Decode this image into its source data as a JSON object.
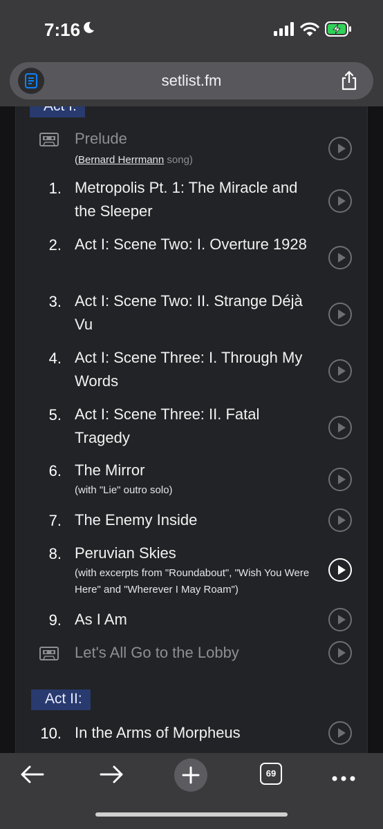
{
  "status": {
    "time": "7:16",
    "icons": [
      "moon-icon",
      "signal-icon",
      "wifi-icon",
      "battery-charging-icon"
    ],
    "battery_color": "#30d158"
  },
  "browser": {
    "url": "setlist.fm",
    "tab_count": "69"
  },
  "setlist": {
    "act1_label": "Act I:",
    "act2_label": "Act II:",
    "accent_color": "#283a6e",
    "items": [
      {
        "num": "",
        "title": "Prelude",
        "note_prefix": "(",
        "note_link": "Bernard Herrmann",
        "note_suffix": " song)",
        "tape": true
      },
      {
        "num": "1.",
        "title": "Metropolis Pt. 1: The Miracle and the Sleeper"
      },
      {
        "num": "2.",
        "title": "Act I: Scene Two: I. Overture 1928"
      },
      {
        "num": "3.",
        "title": "Act I: Scene Two: II. Strange Déjà Vu"
      },
      {
        "num": "4.",
        "title": "Act I: Scene Three: I. Through My Words"
      },
      {
        "num": "5.",
        "title": "Act I: Scene Three: II. Fatal Tragedy"
      },
      {
        "num": "6.",
        "title": "The Mirror",
        "note": "(with \"Lie\" outro solo)"
      },
      {
        "num": "7.",
        "title": "The Enemy Inside"
      },
      {
        "num": "8.",
        "title": "Peruvian Skies",
        "note": "(with excerpts from \"Roundabout\", \"Wish You Were Here\" and \"Wherever I May Roam\")"
      },
      {
        "num": "9.",
        "title": "As I Am"
      },
      {
        "num": "",
        "title": "Let's All Go to the Lobby",
        "tape": true
      },
      {
        "num": "10.",
        "title": "In the Arms of Morpheus"
      }
    ]
  }
}
